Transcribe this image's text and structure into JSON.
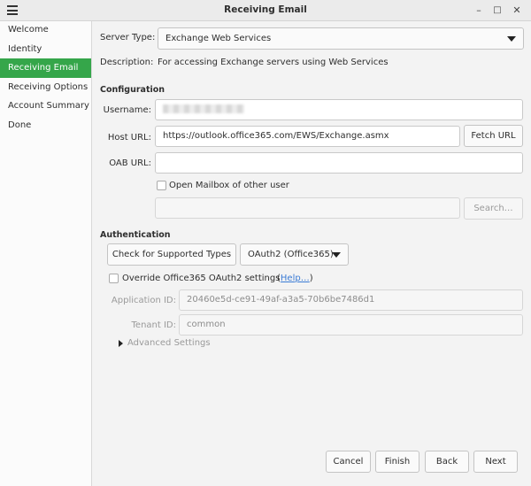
{
  "window": {
    "title": "Receiving Email",
    "minimize_glyph": "–",
    "maximize_glyph": "□",
    "close_glyph": "✕"
  },
  "sidebar": {
    "items": [
      {
        "label": "Welcome",
        "active": false
      },
      {
        "label": "Identity",
        "active": false
      },
      {
        "label": "Receiving Email",
        "active": true
      },
      {
        "label": "Receiving Options",
        "active": false
      },
      {
        "label": "Account Summary",
        "active": false
      },
      {
        "label": "Done",
        "active": false
      }
    ]
  },
  "form": {
    "server_type_label": "Server Type:",
    "server_type_value": "Exchange Web Services",
    "description_label": "Description:",
    "description_value": "For accessing Exchange servers using Web Services",
    "configuration_heading": "Configuration",
    "username_label": "Username:",
    "username_value": "",
    "host_url_label": "Host URL:",
    "host_url_value": "https://outlook.office365.com/EWS/Exchange.asmx",
    "fetch_url_label": "Fetch URL",
    "oab_url_label": "OAB URL:",
    "oab_url_value": "",
    "open_mailbox_label": "Open Mailbox of other user",
    "other_user_value": "",
    "search_label": "Search…",
    "authentication_heading": "Authentication",
    "check_types_label": "Check for Supported Types",
    "auth_method_value": "OAuth2 (Office365)",
    "override_label": "Override Office365 OAuth2 settings",
    "help_open": "(",
    "help_label": "Help…",
    "help_close": ")",
    "application_id_label": "Application ID:",
    "application_id_value": "20460e5d-ce91-49af-a3a5-70b6be7486d1",
    "tenant_id_label": "Tenant ID:",
    "tenant_id_value": "common",
    "advanced_settings_label": "Advanced Settings"
  },
  "footer": {
    "cancel_label": "Cancel",
    "finish_label": "Finish",
    "back_label": "Back",
    "next_label": "Next"
  }
}
